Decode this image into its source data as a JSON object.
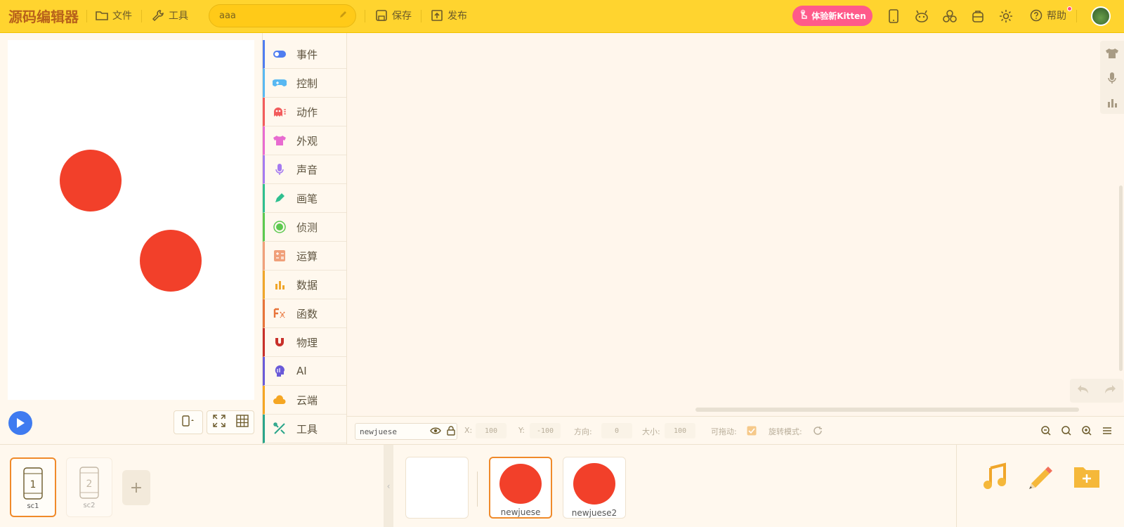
{
  "topbar": {
    "logo": "源码编辑器",
    "file_label": "文件",
    "tools_label": "工具",
    "project_name": "aaa",
    "save_label": "保存",
    "publish_label": "发布",
    "kitten_label": "体验新Kitten",
    "help_label": "帮助",
    "icons": [
      "folder-icon",
      "wrench-icon",
      "pencil-icon",
      "save-icon",
      "publish-icon",
      "hand-icon",
      "tablet-icon",
      "creature-icon",
      "collaboration-icon",
      "backpack-icon",
      "settings-icon",
      "help-icon"
    ]
  },
  "categories": [
    {
      "label": "事件",
      "color": "#4f7df0",
      "icon": "toggle-icon"
    },
    {
      "label": "控制",
      "color": "#58b8f2",
      "icon": "gamepad-icon"
    },
    {
      "label": "动作",
      "color": "#f25c5c",
      "icon": "ghost-icon"
    },
    {
      "label": "外观",
      "color": "#e86bd0",
      "icon": "shirt-icon"
    },
    {
      "label": "声音",
      "color": "#a57af0",
      "icon": "microphone-icon"
    },
    {
      "label": "画笔",
      "color": "#2fbf8f",
      "icon": "pen-icon"
    },
    {
      "label": "侦测",
      "color": "#5cc94f",
      "icon": "radar-icon"
    },
    {
      "label": "运算",
      "color": "#f0a07a",
      "icon": "calculator-icon"
    },
    {
      "label": "数据",
      "color": "#f0a62a",
      "icon": "bar-chart-icon"
    },
    {
      "label": "函数",
      "color": "#e8743a",
      "icon": "function-icon"
    },
    {
      "label": "物理",
      "color": "#c8302a",
      "icon": "magnet-icon"
    },
    {
      "label": "AI",
      "color": "#6a5ad8",
      "icon": "ai-head-icon"
    },
    {
      "label": "云端",
      "color": "#f5a623",
      "icon": "cloud-icon"
    },
    {
      "label": "工具",
      "color": "#2aa58a",
      "icon": "tools-icon"
    }
  ],
  "properties": {
    "sprite_name": "newjuese",
    "x_label": "X:",
    "x_value": "100",
    "y_label": "Y:",
    "y_value": "-100",
    "direction_label": "方向:",
    "direction_value": "0",
    "size_label": "大小:",
    "size_value": "100",
    "draggable_label": "可拖动:",
    "rotation_label": "旋转模式:"
  },
  "scenes": [
    {
      "number": "1",
      "label": "sc1"
    },
    {
      "number": "2",
      "label": "sc2"
    }
  ],
  "add_scene_label": "+",
  "sprites": [
    {
      "name": "newjuese"
    },
    {
      "name": "newjuese2"
    }
  ],
  "colors": {
    "topbar": "#ffd42f",
    "accent": "#f08a2a",
    "sprite": "#f2402a",
    "play": "#3f7bf0",
    "kitten": "#ff5a8a"
  }
}
